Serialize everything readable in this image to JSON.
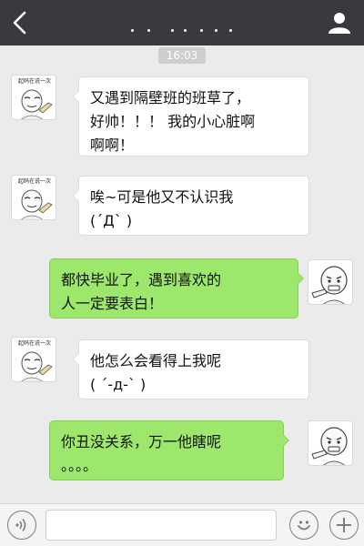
{
  "header": {
    "title": "",
    "back_icon": "chevron-left-icon",
    "profile_icon": "person-icon"
  },
  "timestamp": "16:03",
  "avatar_caption": "起码在说一次",
  "messages": [
    {
      "side": "left",
      "lines": [
        "又遇到隔壁班的班草了，",
        "好帅！！！ 我的小心脏啊",
        "啊啊！"
      ]
    },
    {
      "side": "left",
      "lines": [
        "唉~可是他又不认识我",
        "(´Д` )"
      ]
    },
    {
      "side": "right",
      "lines": [
        "都快毕业了，遇到喜欢的",
        "人一定要表白！"
      ]
    },
    {
      "side": "left",
      "lines": [
        "他怎么会看得上我呢",
        "( ´-д-` )"
      ]
    },
    {
      "side": "right",
      "lines": [
        "你丑没关系，万一他瞎呢",
        "。。。。"
      ]
    }
  ],
  "input": {
    "value": "",
    "placeholder": "",
    "voice_icon": "voice-icon",
    "emoji_icon": "emoji-icon",
    "plus_icon": "plus-icon"
  },
  "colors": {
    "topbar": "#393a3f",
    "background": "#ebebeb",
    "bubble_in": "#ffffff",
    "bubble_out": "#9de86c",
    "timestamp_bg": "#cecece"
  }
}
